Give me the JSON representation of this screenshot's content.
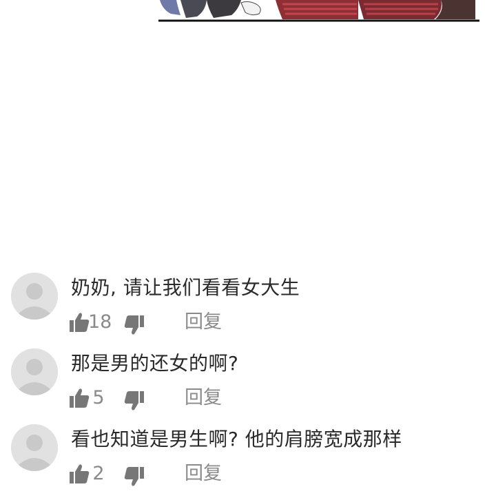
{
  "colors": {
    "avatar_bg": "#e1e1e1",
    "avatar_figure": "#c9c9c9",
    "muted_text": "#8a8a8a",
    "icon": "#777777",
    "comment_text": "#2a2a2a"
  },
  "comments": [
    {
      "text": "奶奶, 请让我们看看女大生",
      "likes": "18",
      "reply_label": "回复",
      "avatar_icon": "default-user-avatar"
    },
    {
      "text": "那是男的还女的啊?",
      "likes": "5",
      "reply_label": "回复",
      "avatar_icon": "default-user-avatar"
    },
    {
      "text": "看也知道是男生啊? 他的肩膀宽成那样",
      "likes": "2",
      "reply_label": "回复",
      "avatar_icon": "default-user-avatar"
    }
  ]
}
